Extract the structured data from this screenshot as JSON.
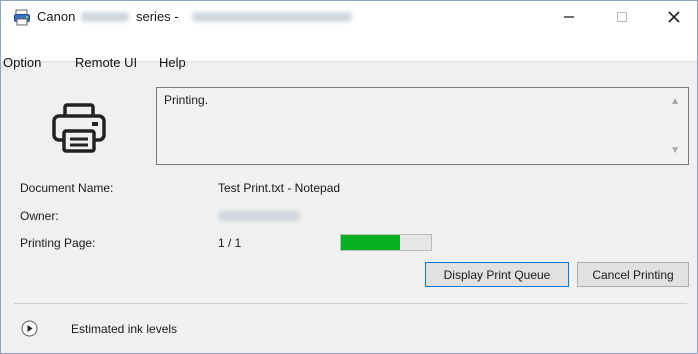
{
  "window": {
    "title_prefix": "Canon",
    "title_series": "series -",
    "controls": {
      "minimize": "—",
      "maximize": "☐",
      "close": "✕"
    }
  },
  "menu": {
    "items": [
      {
        "label": "Option"
      },
      {
        "label": "Remote UI"
      },
      {
        "label": "Help"
      }
    ]
  },
  "status": {
    "message": "Printing.",
    "scroll_up": "▲",
    "scroll_down": "▼"
  },
  "details": {
    "document_name_label": "Document Name:",
    "document_name_value": "Test Print.txt - Notepad",
    "owner_label": "Owner:",
    "printing_page_label": "Printing Page:",
    "printing_page_value": "1 / 1",
    "progress_fraction": 0.65
  },
  "buttons": {
    "display_queue": "Display Print Queue",
    "cancel_printing": "Cancel Printing"
  },
  "ink": {
    "label": "Estimated ink levels"
  },
  "colors": {
    "progress_fill": "#06b025",
    "focus_border": "#0078d7"
  }
}
